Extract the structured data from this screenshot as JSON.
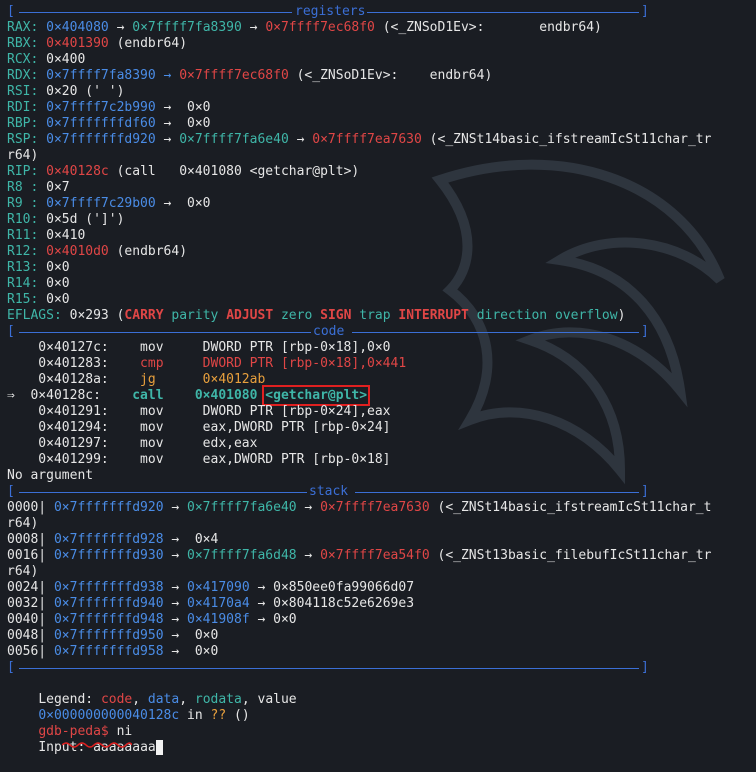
{
  "sections": {
    "registers": "registers",
    "code": "code",
    "stack": "stack"
  },
  "registers": [
    {
      "name": "RAX:",
      "v1": "0×404080",
      "a1": "→",
      "v2": "0×7ffff7fa8390",
      "a2": "→",
      "v3": "0×7ffff7ec68f0",
      "rest": " (<_ZNSoD1Ev>:       endbr64)"
    },
    {
      "name": "RBX:",
      "v1": "0×401390",
      "rest": " (endbr64)"
    },
    {
      "name": "RCX:",
      "plain": " 0×400"
    },
    {
      "name": "RDX:",
      "v1": "0×7ffff7fa8390",
      "a1": "→",
      "v2": "0×7ffff7ec68f0",
      "rest": " (<_ZNSoD1Ev>:    endbr64)"
    },
    {
      "name": "RSI:",
      "plain": " 0×20 (' ')"
    },
    {
      "name": "RDI:",
      "v1": "0×7ffff7c2b990",
      "a1": "→",
      "plain2": " 0×0"
    },
    {
      "name": "RBP:",
      "v1": "0×7fffffffdf60",
      "a1": "→",
      "plain2": " 0×0"
    },
    {
      "name": "RSP:",
      "v1": "0×7fffffffd920",
      "a1": "→",
      "v2": "0×7ffff7fa6e40",
      "a2": "→",
      "v3": "0×7ffff7ea7630",
      "rest": " (<_ZNSt14basic_ifstreamIcSt11char_tr"
    },
    {
      "name": "",
      "plain": "r64)"
    },
    {
      "name": "RIP:",
      "v1": "0×40128c",
      "rest": " (call   0×401080 <getchar@plt>)"
    },
    {
      "name": "R8 :",
      "plain": " 0×7"
    },
    {
      "name": "R9 :",
      "v1": "0×7ffff7c29b00",
      "a1": "→",
      "plain2": " 0×0"
    },
    {
      "name": "R10:",
      "plain": " 0×5d (']')"
    },
    {
      "name": "R11:",
      "plain": " 0×410"
    },
    {
      "name": "R12:",
      "v1": "0×4010d0",
      "rest": " (endbr64)"
    },
    {
      "name": "R13:",
      "plain": " 0×0"
    },
    {
      "name": "R14:",
      "plain": " 0×0"
    },
    {
      "name": "R15:",
      "plain": " 0×0"
    }
  ],
  "eflags": {
    "label": "EFLAGS:",
    "value": " 0×293 (",
    "flags": [
      "CARRY",
      "parity",
      "ADJUST",
      "zero",
      "SIGN",
      "trap",
      "INTERRUPT",
      "direction",
      "overflow"
    ],
    "close": ")"
  },
  "code": [
    {
      "prefix": "   ",
      "addr": "0×40127c:",
      "op": "mov",
      "args": "DWORD PTR [rbp-0×18],0×0"
    },
    {
      "prefix": "   ",
      "addr": "0×401283:",
      "op": "cmp",
      "args": "DWORD PTR [rbp-0×18],0×441"
    },
    {
      "prefix": "   ",
      "addr": "0×40128a:",
      "op": "jg",
      "args": "0×4012ab"
    },
    {
      "prefix": "⇒ ",
      "addr": "0×40128c:",
      "op": "call",
      "args": "0×401080",
      "sym": "<getchar@plt>"
    },
    {
      "prefix": "   ",
      "addr": "0×401291:",
      "op": "mov",
      "args": "DWORD PTR [rbp-0×24],eax"
    },
    {
      "prefix": "   ",
      "addr": "0×401294:",
      "op": "mov",
      "args": "eax,DWORD PTR [rbp-0×24]"
    },
    {
      "prefix": "   ",
      "addr": "0×401297:",
      "op": "mov",
      "args": "edx,eax"
    },
    {
      "prefix": "   ",
      "addr": "0×401299:",
      "op": "mov",
      "args": "eax,DWORD PTR [rbp-0×18]"
    }
  ],
  "no_argument": "No argument",
  "stack": [
    {
      "off": "0000|",
      "addr": "0×7fffffffd920",
      "v1": "0×7ffff7fa6e40",
      "v2": "0×7ffff7ea7630",
      "rest": " (<_ZNSt14basic_ifstreamIcSt11char_t"
    },
    {
      "off": "",
      "plain": "r64)"
    },
    {
      "off": "0008|",
      "addr": "0×7fffffffd928",
      "plain2": " 0×4"
    },
    {
      "off": "0016|",
      "addr": "0×7fffffffd930",
      "v1": "0×7ffff7fa6d48",
      "v2": "0×7ffff7ea54f0",
      "rest": " (<_ZNSt13basic_filebufIcSt11char_tr"
    },
    {
      "off": "",
      "plain": "r64)"
    },
    {
      "off": "0024|",
      "addr": "0×7fffffffd938",
      "v1": "0×417090",
      "plain2": " 0×850ee0fa99066d07"
    },
    {
      "off": "0032|",
      "addr": "0×7fffffffd940",
      "v1": "0×4170a4",
      "plain2": " 0×804118c52e6269e3"
    },
    {
      "off": "0040|",
      "addr": "0×7fffffffd948",
      "v1": "0×41908f",
      "plain2": " 0×0"
    },
    {
      "off": "0048|",
      "addr": "0×7fffffffd950",
      "plain2": " 0×0"
    },
    {
      "off": "0056|",
      "addr": "0×7fffffffd958",
      "plain2": " 0×0"
    }
  ],
  "legend": {
    "label": "Legend: ",
    "code": "code",
    "data": "data",
    "rodata": "rodata",
    "value": "value",
    "sep": ", "
  },
  "location": {
    "addr": "0×000000000040128c",
    "in": " in ",
    "qq": "??",
    "rest": " ()"
  },
  "prompt": {
    "name": "gdb-peda$",
    "cmd": " ni"
  },
  "input": {
    "label": "Input: ",
    "value": "aaaaaaaa"
  },
  "arrow": "→",
  "colors": {
    "background": "#1a1d23",
    "separator": "#3b6fd6",
    "address": "#4a8ce6",
    "heap": "#3fb6a8",
    "code_ptr": "#e04646",
    "rodata": "#e8a03d"
  }
}
